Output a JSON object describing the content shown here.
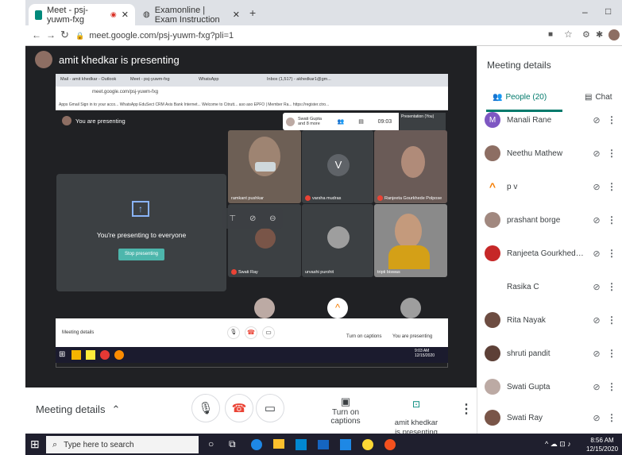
{
  "browser": {
    "tabs": [
      {
        "label": "Meet - psj-yuwm-fxg",
        "active": true
      },
      {
        "label": "Examonline | Exam Instruction",
        "active": false
      }
    ],
    "new_tab": "+",
    "url": "meet.google.com/psj-yuwm-fxg?pli=1",
    "window_controls": [
      "–",
      "□"
    ]
  },
  "meet": {
    "presenter_banner": "amit khedkar is presenting",
    "shared_screen": {
      "inner_tabs": [
        "Mail - amit khedkar - Outlook",
        "Meet - psj-yuwm-fxg",
        "WhatsApp",
        "Inbox (1,517) - akhedkar1@gm..."
      ],
      "inner_url": "meet.google.com/psj-yuwm-fxg",
      "inner_bookmarks": "Apps   Gmail   Sign in to your acco...   WhatsApp   EduSect CRM   Axis Bank Internet...   Welcome to Citrutt...   aso   aso   EPFO | Member Ra...   https://register.ctro...",
      "you_are_presenting": "You are presenting",
      "chip_name": "Swati Gupta\nand 8 more",
      "time": "09:03",
      "presentation_label": "Presentation (You)",
      "card_text": "You're presenting to everyone",
      "stop_button": "Stop presenting",
      "tiles": [
        "ramkant pushkar",
        "varsha mudras",
        "Ranjeeta Gourkhede Polpose",
        "Swati Ray",
        "urvashi purohit",
        "tripti biswas"
      ],
      "v_letter": "V",
      "inner_meeting_details": "Meeting details",
      "inner_turn_on_captions": "Turn on captions",
      "inner_you_are_presenting": "You are presenting",
      "inner_clock": "9:03 AM\n12/15/2020"
    },
    "bottom": {
      "meeting_details": "Meeting details",
      "captions": "Turn on captions",
      "presenting": "amit khedkar\nis presenting"
    }
  },
  "panel": {
    "title": "Meeting details",
    "people_tab": "People (20)",
    "chat_tab": "Chat",
    "participants": [
      {
        "name": "Manali Rane",
        "color": "#7e57c2",
        "letter": "M"
      },
      {
        "name": "Neethu Mathew",
        "color": "#8d6e63",
        "letter": ""
      },
      {
        "name": "p v",
        "color": "#f57c00",
        "letter": "^"
      },
      {
        "name": "prashant borge",
        "color": "#a1887f",
        "letter": ""
      },
      {
        "name": "Ranjeeta Gourkhede Po...",
        "color": "#c62828",
        "letter": ""
      },
      {
        "name": "Rasika C",
        "color": "#ffffff",
        "letter": ""
      },
      {
        "name": "Rita Nayak",
        "color": "#6d4c41",
        "letter": ""
      },
      {
        "name": "shruti pandit",
        "color": "#5d4037",
        "letter": ""
      },
      {
        "name": "Swati Gupta",
        "color": "#bcaaa4",
        "letter": ""
      },
      {
        "name": "Swati Ray",
        "color": "#795548",
        "letter": ""
      }
    ]
  },
  "taskbar": {
    "search_placeholder": "Type here to search",
    "clock_time": "8:56 AM",
    "clock_date": "12/15/2020"
  }
}
